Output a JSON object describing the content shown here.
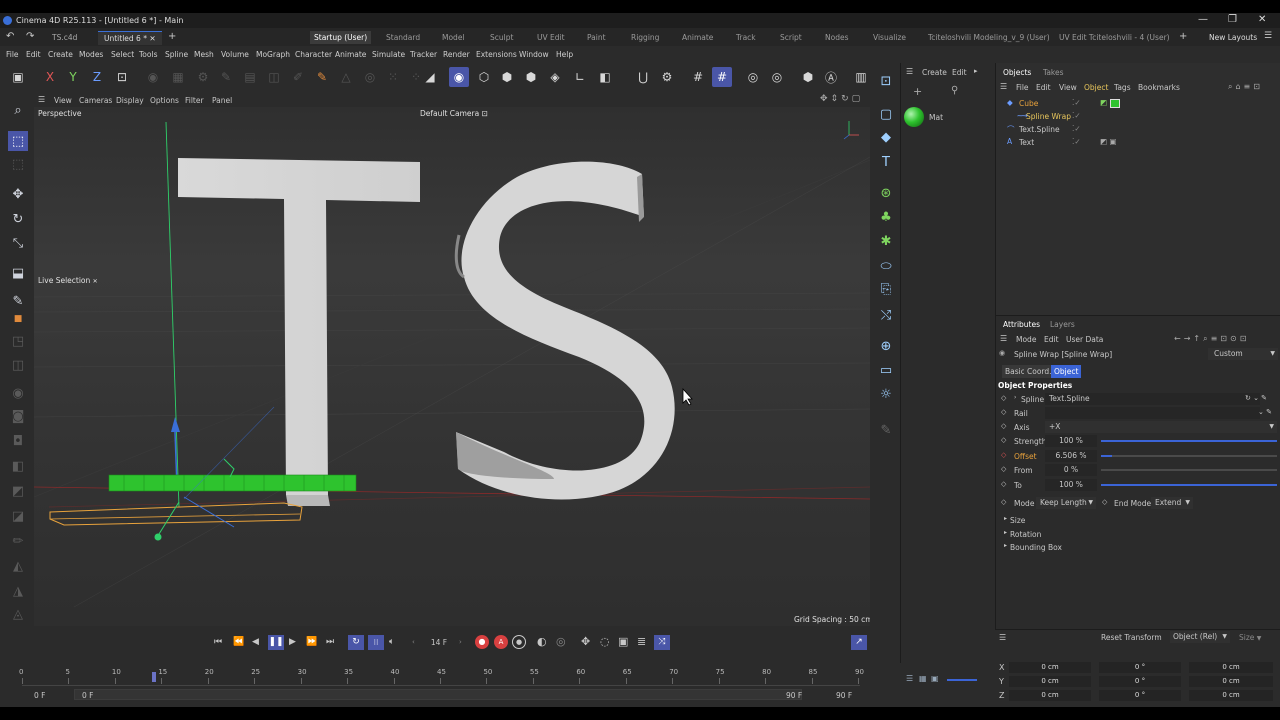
{
  "window": {
    "title": "Cinema 4D R25.113 - [Untitled 6 *] - Main"
  },
  "file_tabs": [
    "TS.c4d",
    "Untitled 6 *"
  ],
  "layouts": [
    "Startup (User)",
    "Standard",
    "Model",
    "Sculpt",
    "UV Edit",
    "Paint",
    "Rigging",
    "Animate",
    "Track",
    "Script",
    "Nodes",
    "Visualize",
    "Tciteloshvili Modeling_v_9 (User)",
    "UV Edit Tciteloshvili - 4 (User)"
  ],
  "new_layouts": "New Layouts",
  "menus": [
    "File",
    "Edit",
    "Create",
    "Modes",
    "Select",
    "Tools",
    "Spline",
    "Mesh",
    "Volume",
    "MoGraph",
    "Character",
    "Animate",
    "Simulate",
    "Tracker",
    "Render",
    "Extensions",
    "Window",
    "Help"
  ],
  "viewport": {
    "menu": [
      "View",
      "Cameras",
      "Display",
      "Options",
      "Filter",
      "Panel"
    ],
    "name": "Perspective",
    "camera": "Default Camera",
    "mode": "Live Selection",
    "grid": "Grid Spacing : 50 cm"
  },
  "materials": {
    "menu": [
      "Create",
      "Edit"
    ],
    "items": [
      {
        "name": "Mat",
        "color": "#2ec32e"
      }
    ]
  },
  "objects": {
    "tabs": [
      "Objects",
      "Takes"
    ],
    "menu": [
      "File",
      "Edit",
      "View",
      "Object",
      "Tags",
      "Bookmarks"
    ],
    "items": [
      {
        "name": "Cube",
        "color": "#e8a23c"
      },
      {
        "name": "Spline Wrap",
        "color": "#e8c65c"
      },
      {
        "name": "Text.Spline",
        "color": "#c8c8c8"
      },
      {
        "name": "Text",
        "color": "#c8c8c8"
      }
    ]
  },
  "attributes": {
    "tabs": [
      "Attributes",
      "Layers"
    ],
    "menu": [
      "Mode",
      "Edit",
      "User Data"
    ],
    "object_title": "Spline Wrap [Spline Wrap]",
    "preset": "Custom",
    "subtabs": [
      "Basic",
      "Coord.",
      "Object"
    ],
    "section": "Object Properties",
    "fields": [
      {
        "label": "Spline",
        "value": "Text.Spline"
      },
      {
        "label": "Rail",
        "value": ""
      },
      {
        "label": "Axis",
        "value": "+X"
      },
      {
        "label": "Strength",
        "value": "100 %",
        "level": 1.0
      },
      {
        "label": "Offset",
        "value": "6.506 %",
        "level": 0.065
      },
      {
        "label": "From",
        "value": "0 %",
        "level": 0.0
      },
      {
        "label": "To",
        "value": "100 %",
        "level": 1.0
      }
    ],
    "mode_label": "Mode",
    "mode_value": "Keep Length",
    "end_label": "End Mode",
    "end_value": "Extend",
    "groups": [
      "Size",
      "Rotation",
      "Bounding Box"
    ]
  },
  "coords": {
    "buttons": [
      "Reset Transform",
      "Object (Rel)",
      "Size"
    ],
    "axes": [
      "X",
      "Y",
      "Z"
    ],
    "pos": [
      "0 cm",
      "0 cm",
      "0 cm"
    ],
    "rot": [
      "0 °",
      "0 °",
      "0 °"
    ],
    "size": [
      "0 cm",
      "0 cm",
      "0 cm"
    ]
  },
  "timeline": {
    "frame": "14 F",
    "ticks": [
      "0",
      "5",
      "10",
      "15",
      "20",
      "25",
      "30",
      "35",
      "40",
      "45",
      "50",
      "55",
      "60",
      "65",
      "70",
      "75",
      "80",
      "85",
      "90"
    ],
    "start": "0 F",
    "range_start": "0 F",
    "range_end": "90 F",
    "end": "90 F",
    "current_fraction": 0.155
  }
}
